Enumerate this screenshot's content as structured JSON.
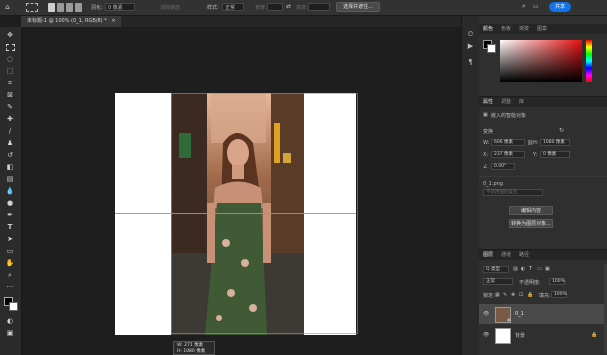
{
  "options_bar": {
    "feather_label": "羽化:",
    "feather_value": "0 像素",
    "antialias_label": "消除锯齿",
    "style_label": "样式:",
    "style_value": "正常",
    "width_label": "宽度:",
    "height_label": "高度:",
    "select_subject": "选择并遮住...",
    "share": "共享"
  },
  "document_tab": {
    "title": "未标题-1 @ 100% (0_1, RGB/8) *",
    "close": "×"
  },
  "canvas_tooltip": {
    "w": "W:  271 像素",
    "h": "H:  1080 像素"
  },
  "color_panel": {
    "tabs": [
      "颜色",
      "色板",
      "渐变",
      "图案"
    ],
    "active_tab": 0,
    "foreground": "#000000",
    "background": "#ffffff"
  },
  "properties_panel": {
    "tabs": [
      "属性",
      "调整",
      "库"
    ],
    "active_tab": 0,
    "object_type": "嵌入的智能对象",
    "transform_label": "变换",
    "w_label": "W:",
    "w_value": "606 像素",
    "h_label": "H:",
    "h_value": "1080 像素",
    "x_label": "X:",
    "x_value": "237 像素",
    "y_label": "Y:",
    "y_value": "0 像素",
    "angle_value": "0.00°",
    "filename": "0_1.png",
    "comp_placeholder": "不适用图层复合",
    "edit_contents": "编辑内容",
    "convert_to_layers": "转换为图层对象..."
  },
  "layers_panel": {
    "tabs": [
      "图层",
      "通道",
      "路径"
    ],
    "active_tab": 0,
    "filter_kind": "Q 类型",
    "blend_mode": "正常",
    "opacity_label": "不透明度:",
    "opacity_value": "100%",
    "lock_label": "锁定:",
    "fill_label": "填充:",
    "fill_value": "100%",
    "layers": [
      {
        "name": "0_1",
        "visible": true,
        "selected": true
      },
      {
        "name": "背景",
        "visible": true,
        "selected": false
      }
    ]
  },
  "colors": {
    "accent": "#1473e6",
    "panel_bg": "#2f2f2f",
    "canvas_bg": "#1e1e1e",
    "guide": "#b07bd6"
  }
}
